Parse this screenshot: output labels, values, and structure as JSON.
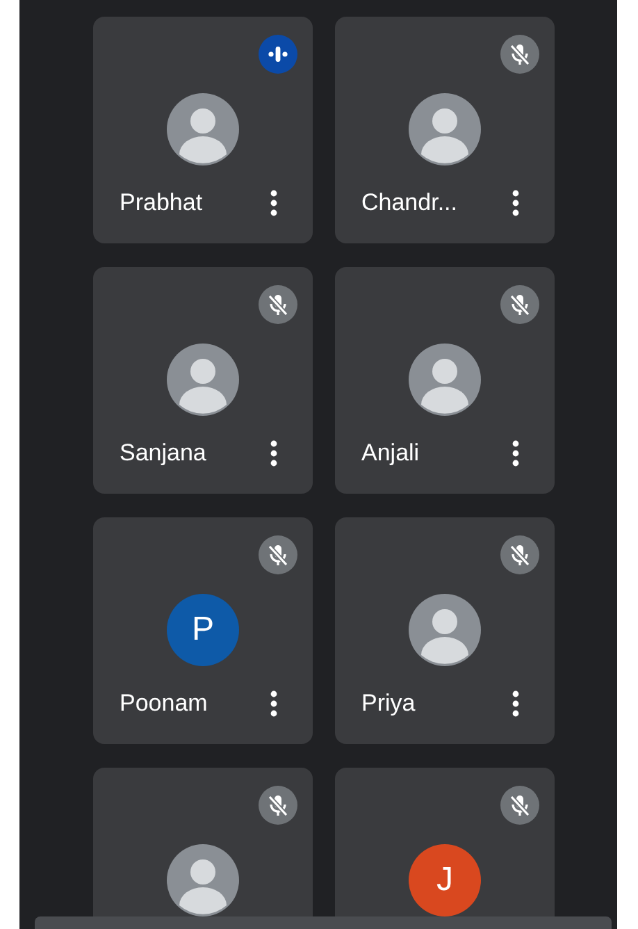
{
  "participants": [
    {
      "name": "Prabhat",
      "muted": false,
      "avatar": {
        "kind": "photo"
      }
    },
    {
      "name": "Chandr...",
      "muted": true,
      "avatar": {
        "kind": "photo"
      }
    },
    {
      "name": "Sanjana",
      "muted": true,
      "avatar": {
        "kind": "photo"
      }
    },
    {
      "name": "Anjali",
      "muted": true,
      "avatar": {
        "kind": "photo"
      }
    },
    {
      "name": "Poonam",
      "muted": true,
      "avatar": {
        "kind": "initial",
        "letter": "P",
        "color": "#0e5aa8"
      }
    },
    {
      "name": "Priya",
      "muted": true,
      "avatar": {
        "kind": "photo"
      }
    },
    {
      "muted": true,
      "avatar": {
        "kind": "photo"
      }
    },
    {
      "muted": true,
      "avatar": {
        "kind": "initial",
        "letter": "J",
        "color": "#d9481f"
      }
    }
  ]
}
